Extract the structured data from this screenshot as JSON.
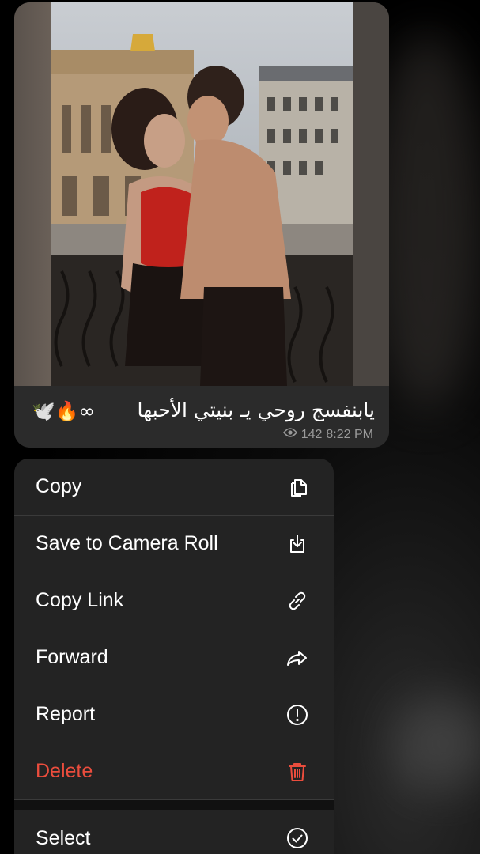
{
  "message": {
    "caption_text": "يابنفسج روحي يـ بنيتي الأحبها",
    "caption_emoji": "🕊️🔥∞",
    "views": "142",
    "time": "8:22 PM",
    "icons": {
      "views": "eye-icon"
    }
  },
  "menu": {
    "items": [
      {
        "label": "Copy",
        "icon": "copy-icon"
      },
      {
        "label": "Save to Camera Roll",
        "icon": "save-download-icon"
      },
      {
        "label": "Copy Link",
        "icon": "link-icon"
      },
      {
        "label": "Forward",
        "icon": "forward-arrow-icon"
      },
      {
        "label": "Report",
        "icon": "exclamation-circle-icon"
      },
      {
        "label": "Delete",
        "icon": "trash-icon",
        "color": "#eb4d3d"
      },
      {
        "label": "Select",
        "icon": "checkmark-circle-icon"
      }
    ]
  },
  "colors": {
    "menu_background": "#232323",
    "danger": "#eb4d3d",
    "bubble_background": "#2b2b2b"
  }
}
